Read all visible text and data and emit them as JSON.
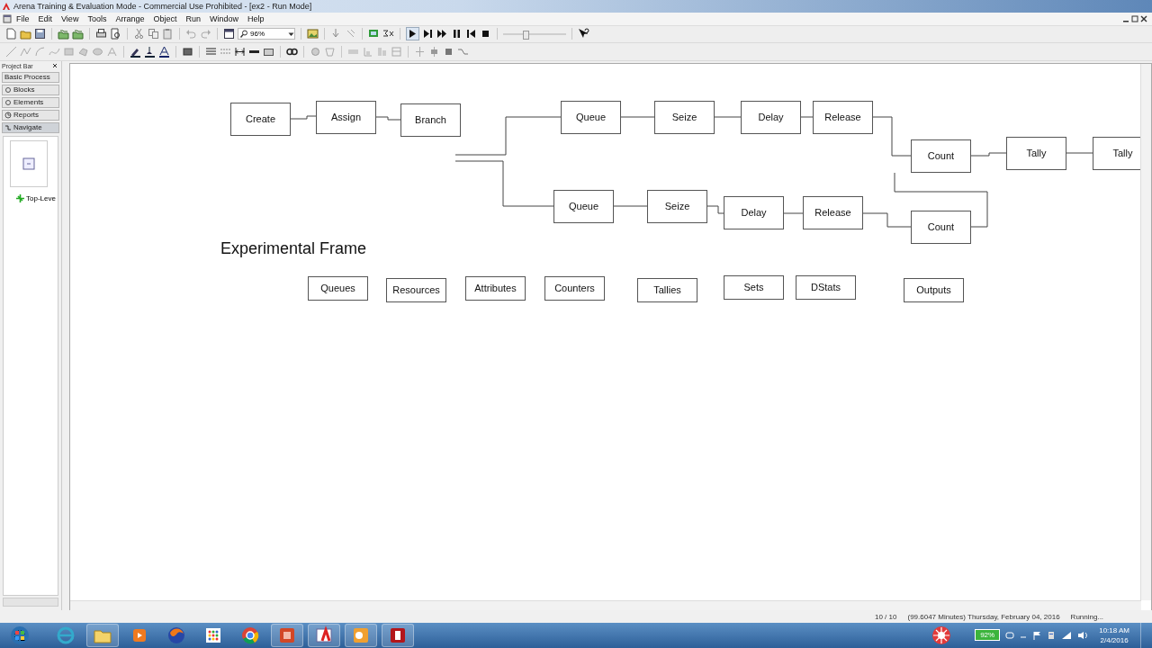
{
  "window": {
    "title": "Arena Training & Evaluation Mode - Commercial Use Prohibited - [ex2 - Run Mode]"
  },
  "menu": [
    "File",
    "Edit",
    "View",
    "Tools",
    "Arrange",
    "Object",
    "Run",
    "Window",
    "Help"
  ],
  "toolbar": {
    "zoom": "96%",
    "speed_slider": {
      "level": 0.35
    }
  },
  "project_bar": {
    "title": "Project Bar",
    "panels": [
      {
        "label": "Basic Process",
        "selected": false
      },
      {
        "label": "Blocks",
        "selected": false
      },
      {
        "label": "Elements",
        "selected": false
      },
      {
        "label": "Reports",
        "selected": false
      },
      {
        "label": "Navigate",
        "selected": true
      }
    ],
    "tree": [
      {
        "label": "Top-Leve"
      }
    ]
  },
  "canvas": {
    "modules": [
      {
        "label": "Create"
      },
      {
        "label": "Assign"
      },
      {
        "label": "Branch"
      },
      {
        "label": "Queue"
      },
      {
        "label": "Seize"
      },
      {
        "label": "Delay"
      },
      {
        "label": "Release"
      },
      {
        "label": "Count"
      },
      {
        "label": "Tally"
      },
      {
        "label": "Tally"
      },
      {
        "label": "Queue"
      },
      {
        "label": "Seize"
      },
      {
        "label": "Delay"
      },
      {
        "label": "Release"
      },
      {
        "label": "Count"
      }
    ],
    "heading": "Experimental Frame",
    "data_modules": [
      {
        "label": "Queues"
      },
      {
        "label": "Resources"
      },
      {
        "label": "Attributes"
      },
      {
        "label": "Counters"
      },
      {
        "label": "Tallies"
      },
      {
        "label": "Sets"
      },
      {
        "label": "DStats"
      },
      {
        "label": "Outputs"
      }
    ]
  },
  "status_bar": {
    "replication": "10 / 10",
    "sim_time": "(99.6047 Minutes) Thursday, February 04, 2016",
    "state": "Running..."
  },
  "taskbar": {
    "battery": "92%",
    "time": "10:18 AM",
    "date": "2/4/2016"
  }
}
